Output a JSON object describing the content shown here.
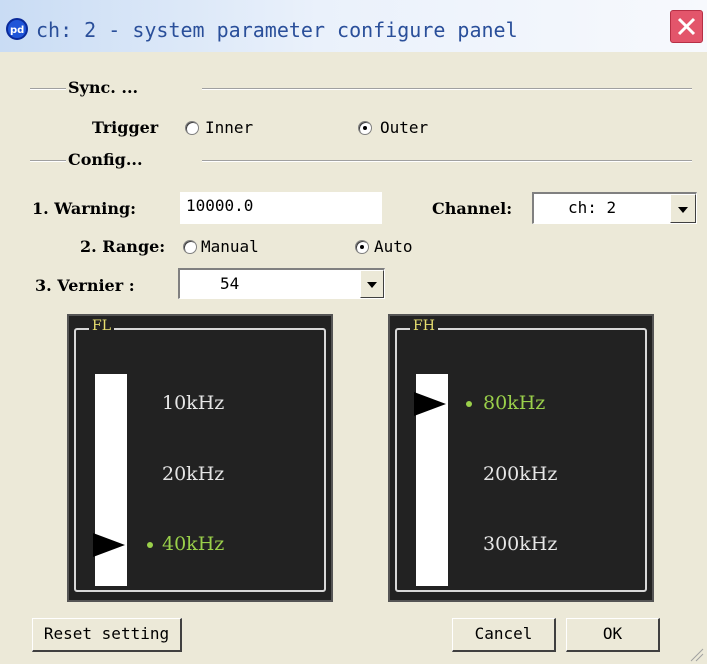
{
  "window": {
    "title": "ch: 2 - system parameter configure panel"
  },
  "sync": {
    "group_label": "Sync. ...",
    "trigger_label": "Trigger",
    "options": [
      {
        "label": "Inner",
        "selected": false
      },
      {
        "label": "Outer",
        "selected": true
      }
    ]
  },
  "config": {
    "group_label": "Config...",
    "warning_label": "1. Warning:",
    "warning_value": "10000.0",
    "channel_label": "Channel:",
    "channel_value": "ch: 2",
    "range_label": "2. Range:",
    "range_options": [
      {
        "label": "Manual",
        "selected": false
      },
      {
        "label": "Auto",
        "selected": true
      }
    ],
    "vernier_label": "3. Vernier :",
    "vernier_value": "54"
  },
  "fl": {
    "title": "FL",
    "options": [
      "10kHz",
      "20kHz",
      "40kHz"
    ],
    "selected": "40kHz"
  },
  "fh": {
    "title": "FH",
    "options": [
      "80kHz",
      "200kHz",
      "300kHz"
    ],
    "selected": "80kHz"
  },
  "buttons": {
    "reset": "Reset setting",
    "cancel": "Cancel",
    "ok": "OK"
  },
  "colors": {
    "active_freq": "#9ad04a",
    "panel_bg": "#222222",
    "title_text": "#2a4f9a"
  }
}
